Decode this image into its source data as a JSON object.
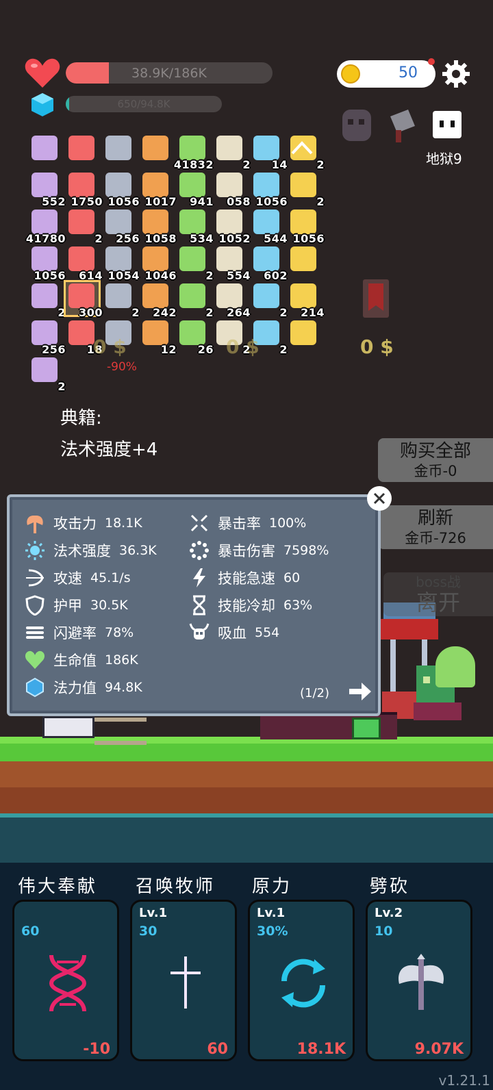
{
  "status": {
    "hp_text": "38.9K/186K",
    "hp_ratio": 0.209,
    "mp_text": "650/94.8K",
    "mp_ratio": 0.007,
    "coins": "50"
  },
  "boss": {
    "stage_label": "地狱9"
  },
  "items": [
    {
      "icon": "scroll-purple",
      "count": ""
    },
    {
      "icon": "scroll-purple",
      "count": ""
    },
    {
      "icon": "scroll-purple",
      "count": ""
    },
    {
      "icon": "star-card",
      "count": ""
    },
    {
      "icon": "watermelon",
      "count": "41832"
    },
    {
      "icon": "suitcase",
      "count": "2"
    },
    {
      "icon": "moon-stone",
      "count": "14"
    },
    {
      "icon": "cards",
      "count": "2"
    },
    {
      "icon": "crossbow",
      "count": "552"
    },
    {
      "icon": "book",
      "count": "1750"
    },
    {
      "icon": "potion-jar",
      "count": "1056"
    },
    {
      "icon": "dagger",
      "count": "1017"
    },
    {
      "icon": "apple",
      "count": "941"
    },
    {
      "icon": "pill",
      "count": "058"
    },
    {
      "icon": "chat",
      "count": "1056"
    },
    {
      "icon": "dice",
      "count": "2"
    },
    {
      "icon": "scroll",
      "count": "41780"
    },
    {
      "icon": "sundae",
      "count": "2"
    },
    {
      "icon": "flag",
      "count": "256"
    },
    {
      "icon": "flask",
      "count": "1058"
    },
    {
      "icon": "pineapple",
      "count": "534"
    },
    {
      "icon": "green-flask",
      "count": "1052"
    },
    {
      "icon": "sunflower",
      "count": "544"
    },
    {
      "icon": "beer",
      "count": "1056"
    },
    {
      "icon": "egg",
      "count": "1056"
    },
    {
      "icon": "door",
      "count": "614"
    },
    {
      "icon": "shield",
      "count": "1054"
    },
    {
      "icon": "capsule",
      "count": "1046"
    },
    {
      "icon": "map",
      "count": "2"
    },
    {
      "icon": "wand",
      "count": "554"
    },
    {
      "icon": "red-card",
      "count": "602"
    },
    {
      "icon": "compass",
      "count": ""
    },
    {
      "icon": "heat",
      "count": "2"
    },
    {
      "icon": "sword-card",
      "count": "300"
    },
    {
      "icon": "treasure-map",
      "count": "2"
    },
    {
      "icon": "mango",
      "count": "242"
    },
    {
      "icon": "spiral",
      "count": "2"
    },
    {
      "icon": "jellyfish",
      "count": "264"
    },
    {
      "icon": "molecule",
      "count": "2"
    },
    {
      "icon": "flower",
      "count": "214"
    },
    {
      "icon": "jam",
      "count": "256"
    },
    {
      "icon": "strawberry",
      "count": "18"
    },
    {
      "icon": "elephant",
      "count": ""
    },
    {
      "icon": "mail",
      "count": "12"
    },
    {
      "icon": "heart",
      "count": "26"
    },
    {
      "icon": "potion-blue",
      "count": "2"
    },
    {
      "icon": "",
      "count": "2"
    },
    {
      "icon": "crystal",
      "count": ""
    },
    {
      "icon": "demon",
      "count": "2"
    }
  ],
  "shop": {
    "price_1": "0 $",
    "price_2": "0 $",
    "price_3": "0 $",
    "discount": "-90%",
    "book_title": "典籍:",
    "book_effect": "法术强度+4",
    "buy_all": "购买全部",
    "buy_all_cost": "金币-0",
    "refresh": "刷新",
    "refresh_cost": "金币-726",
    "boss_fight": "boss战",
    "leave": "离开"
  },
  "stats": {
    "left": [
      {
        "label": "攻击力",
        "value": "18.1K"
      },
      {
        "label": "法术强度",
        "value": "36.3K"
      },
      {
        "label": "攻速",
        "value": "45.1/s"
      },
      {
        "label": "护甲",
        "value": "30.5K"
      },
      {
        "label": "闪避率",
        "value": "78%"
      },
      {
        "label": "生命值",
        "value": "186K"
      },
      {
        "label": "法力值",
        "value": "94.8K"
      }
    ],
    "right": [
      {
        "label": "暴击率",
        "value": "100%"
      },
      {
        "label": "暴击伤害",
        "value": "7598%"
      },
      {
        "label": "技能急速",
        "value": "60"
      },
      {
        "label": "技能冷却",
        "value": "63%"
      },
      {
        "label": "吸血",
        "value": "554"
      }
    ],
    "pager": "(1/2)"
  },
  "skills": [
    {
      "name": "伟大奉献",
      "level": "",
      "stat": "60",
      "damage": "-10",
      "icon": "dna-icon"
    },
    {
      "name": "召唤牧师",
      "level": "Lv.1",
      "stat": "30",
      "damage": "60",
      "icon": "cross-icon"
    },
    {
      "name": "原力",
      "level": "Lv.1",
      "stat": "30%",
      "damage": "18.1K",
      "icon": "cycle-icon"
    },
    {
      "name": "劈砍",
      "level": "Lv.2",
      "stat": "10",
      "damage": "9.07K",
      "icon": "axe-icon"
    }
  ],
  "version": "v1.21.1"
}
